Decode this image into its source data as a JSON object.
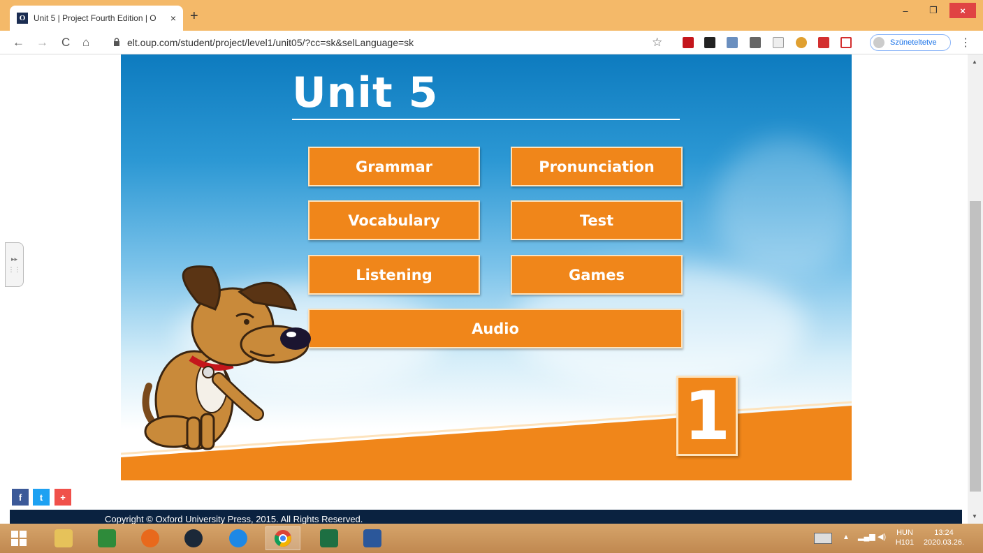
{
  "browser": {
    "tab_title": "Unit 5 | Project Fourth Edition | O",
    "tab_favicon": "O",
    "new_tab_label": "+",
    "close_tab_label": "×",
    "url": "elt.oup.com/student/project/level1/unit05/?cc=sk&selLanguage=sk",
    "profile_label": "Szüneteltetve",
    "window_controls": {
      "minimize": "–",
      "restore": "❐",
      "close": "×"
    },
    "nav": {
      "back": "←",
      "forward": "→",
      "reload": "C",
      "home": "⌂",
      "bookmark": "☆",
      "menu": "⋮"
    }
  },
  "page": {
    "unit_title": "Unit 5",
    "menu_buttons": {
      "grammar": "Grammar",
      "pronunciation": "Pronunciation",
      "vocabulary": "Vocabulary",
      "test": "Test",
      "listening": "Listening",
      "games": "Games",
      "audio": "Audio"
    },
    "level_number": "1",
    "share": {
      "facebook": "f",
      "twitter": "t",
      "more": "+"
    },
    "footer_text": "Copyright © Oxford University Press, 2015. All Rights Reserved."
  },
  "taskbar": {
    "language": "HUN",
    "keyboard_layout": "H101",
    "time": "13:24",
    "date": "2020.03.26."
  },
  "colors": {
    "accent_orange": "#f0861a",
    "sky_blue": "#0d7bbf",
    "footer_navy": "#0a2240"
  }
}
